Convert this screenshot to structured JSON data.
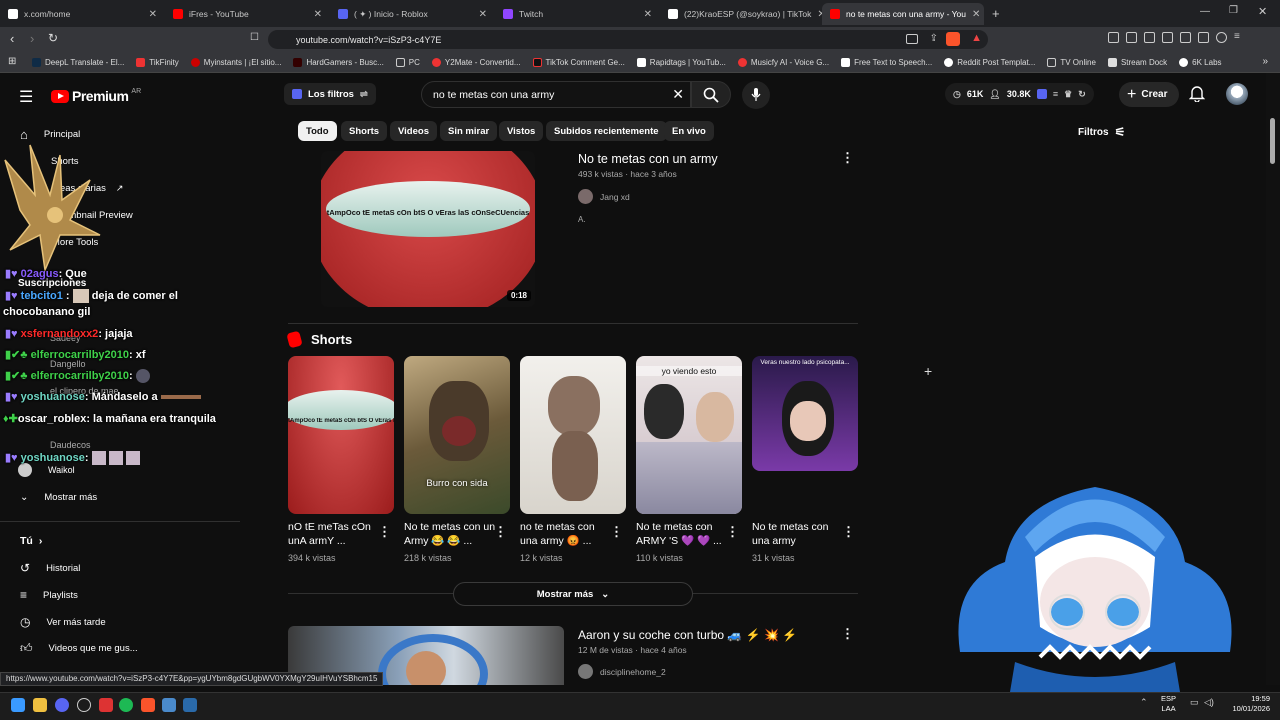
{
  "browser": {
    "tabs": [
      {
        "title": "x.com/home",
        "color": "#ffffff"
      },
      {
        "title": "iFres - YouTube",
        "color": "#ff0000"
      },
      {
        "title": "( ✦ ) Inicio - Roblox",
        "color": "#5865f2"
      },
      {
        "title": "Twitch",
        "color": "#9146ff"
      },
      {
        "title": "(22)KraoESP (@soykrao) | TikTok",
        "color": "#ffffff"
      },
      {
        "title": "no te metas con una army - You",
        "color": "#ff0000"
      }
    ],
    "url": "youtube.com/watch?v=iSzP3-c4Y7E",
    "status_url": "https://www.youtube.com/watch?v=iSzP3-c4Y7E&pp=ygUYbm8gdGUgbWV0YXMgY29uIHVuYSBhcm15",
    "bookmarks": [
      "DeepL Translate - El...",
      "TikFinity",
      "Myinstants | ¡El sitio...",
      "HardGamers - Busc...",
      "PC",
      "Y2Mate - Convertid...",
      "TikTok Comment Ge...",
      "Rapidtags | YouTub...",
      "Musicfy AI - Voice G...",
      "Free Text to Speech...",
      "Reddit Post Templat...",
      "TV Online",
      "Stream Dock",
      "6K Labs"
    ]
  },
  "youtube": {
    "logo": "Premium",
    "logo_region": "AR",
    "filters_label": "Los filtros",
    "search_value": "no te metas con una army",
    "stats": {
      "a": "61K",
      "b": "30.8K"
    },
    "create_label": "Crear",
    "chips": [
      "Todo",
      "Shorts",
      "Videos",
      "Sin mirar",
      "Vistos",
      "Subidos recientemente",
      "En vivo"
    ],
    "filters_right": "Filtros",
    "sidebar": {
      "top": [
        "Principal",
        "Shorts",
        "Ideas diarias",
        "Thumbnail Preview",
        "More Tools"
      ],
      "subs_title": "Suscripciones",
      "subs": [
        "Sadeey",
        "Dangello",
        "el clipero de mae",
        "Daudecos",
        "Waikol"
      ],
      "show_more": "Mostrar más",
      "you_title": "Tú",
      "you_items": [
        "Historial",
        "Playlists",
        "Ver más tarde",
        "Videos que me gus..."
      ]
    },
    "video1": {
      "title": "No te metas con un army",
      "meta": "493 k vistas · hace 3 años",
      "channel": "Jang xd",
      "desc": "A.",
      "duration": "0:18",
      "overlay": "tAmpOco tE metaS cOn btS O vEras laS cOnSeCUencias"
    },
    "shorts_title": "Shorts",
    "shorts": [
      {
        "title": "nO tE meTas cOn unA armY ...",
        "views": "394 k vistas",
        "caption": "tAmpOco tE metaS cOn btS O vEras laS cOnSeCUencias"
      },
      {
        "title": "No te metas con un Army 😂 😂 ...",
        "views": "218 k vistas",
        "caption": "Burro con sida"
      },
      {
        "title": "no te metas con una army 😡 ...",
        "views": "12 k vistas",
        "caption": ""
      },
      {
        "title": "No te metas con ARMY 'S 💜 💜 ...",
        "views": "110 k vistas",
        "caption": "yo viendo esto"
      },
      {
        "title": "No te metas con una army",
        "views": "31 k vistas",
        "caption": "Veras nuestro lado psicopata..."
      }
    ],
    "shorts_more": "Mostrar más",
    "video2": {
      "title": "Aaron y su coche con turbo 🚙 ⚡ 💥 ⚡",
      "meta": "12 M de vistas · hace 4 años",
      "channel": "disciplinehome_2"
    }
  },
  "chat": [
    {
      "user": "02agus",
      "user_color": "#8a5cff",
      "msg": ": Que"
    },
    {
      "user": "tebcito1",
      "user_color": "#4aa8ff",
      "msg": "deja de comer el"
    },
    {
      "user": "",
      "user_color": "#ffffff",
      "msg": "chocobanano gil"
    },
    {
      "user": "xsfernandoxx2",
      "user_color": "#ff2a2a",
      "msg": ": jajaja"
    },
    {
      "user": "elferrocarrilby2010",
      "user_color": "#3fd14a",
      "msg": ": xf"
    },
    {
      "user": "elferrocarrilby2010",
      "user_color": "#3fd14a",
      "msg": ":"
    },
    {
      "user": "yoshuanose",
      "user_color": "#6fd6c4",
      "msg": ": Mándaselo a"
    },
    {
      "user": "oscar_roblex",
      "user_color": "#ffffff",
      "msg": ": la mañana era tranquila"
    },
    {
      "user": "yoshuanose",
      "user_color": "#6fd6c4",
      "msg": ":"
    }
  ],
  "taskbar": {
    "lang": "ESP",
    "lang2": "LAA",
    "time": "19:59",
    "date": "10/01/2026"
  }
}
